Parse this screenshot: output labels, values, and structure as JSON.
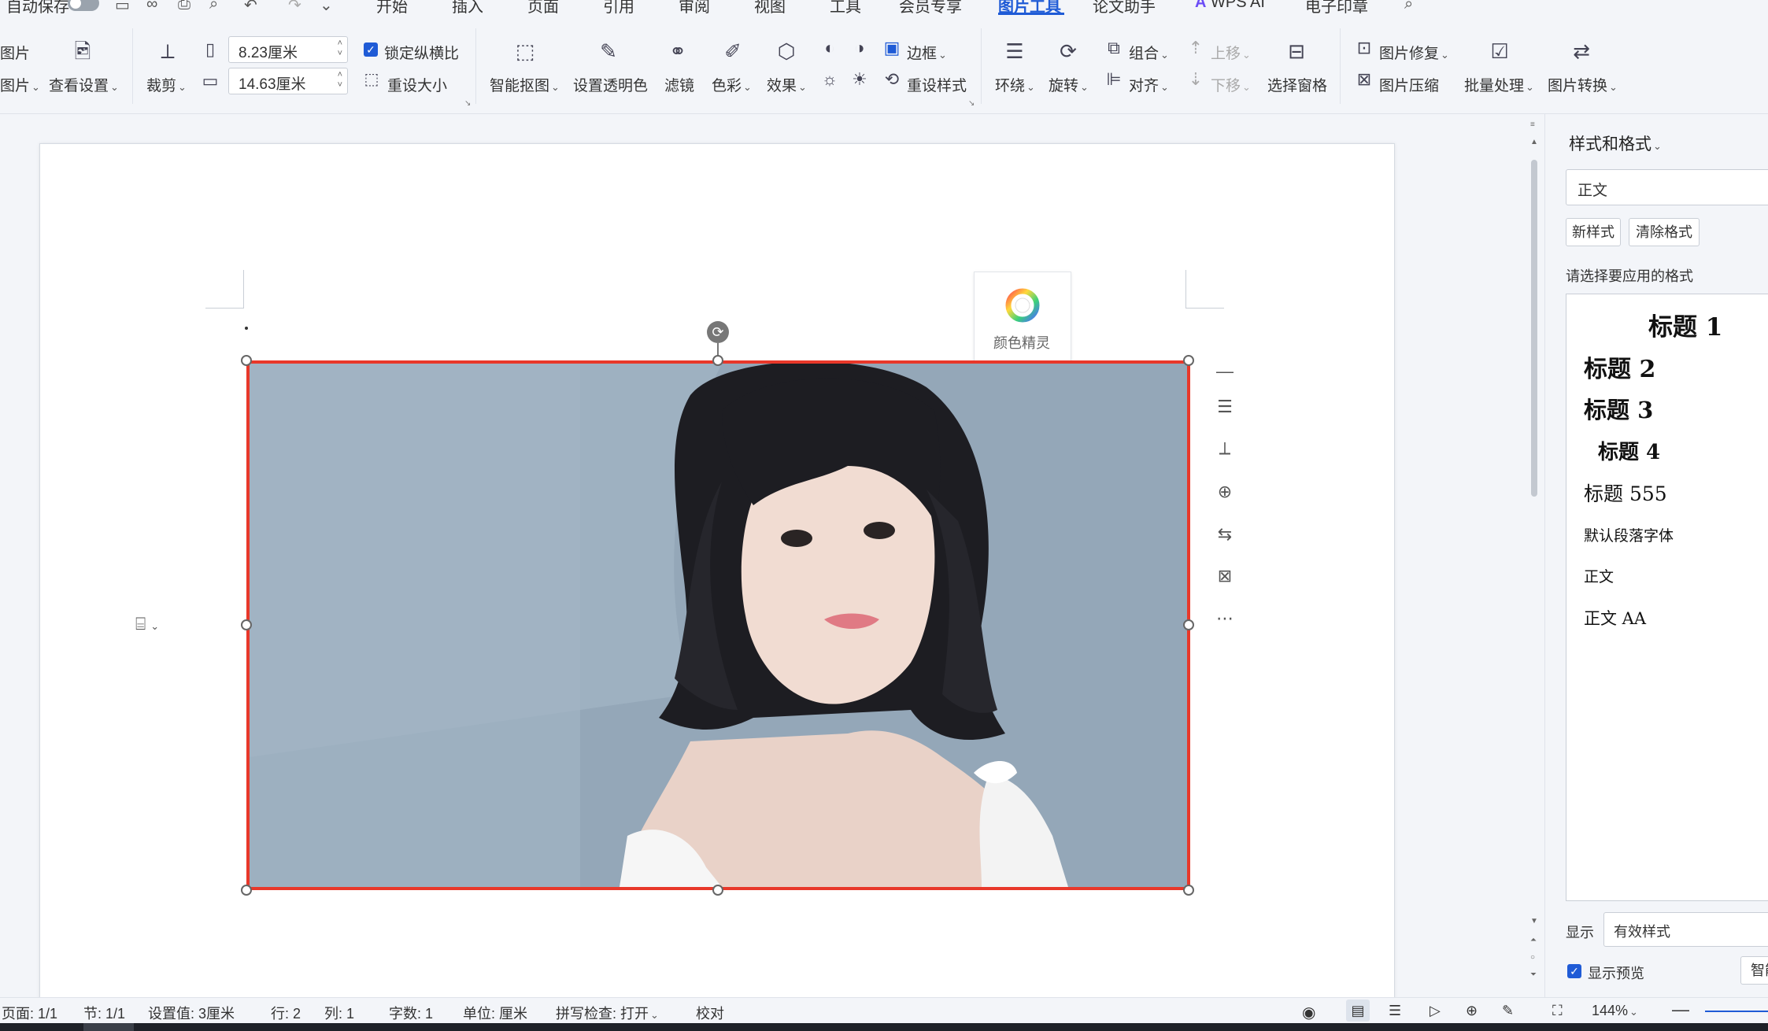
{
  "quick_access": {
    "autosave_label": "自动保存"
  },
  "menu": {
    "tabs": [
      "开始",
      "插入",
      "页面",
      "引用",
      "审阅",
      "视图",
      "工具",
      "会员专享",
      "图片工具",
      "论文助手",
      "WPS AI",
      "电子印章"
    ],
    "active_tab": "图片工具"
  },
  "ribbon": {
    "cut_off_1": "图片",
    "cut_off_2": "图片",
    "view_settings": "查看设置",
    "crop": "裁剪",
    "width_value": "8.23厘米",
    "height_value": "14.63厘米",
    "lock_ratio": "锁定纵横比",
    "reset_size": "重设大小",
    "smart_matting": "智能抠图",
    "set_transparent": "设置透明色",
    "filter": "滤镜",
    "color": "色彩",
    "effect": "效果",
    "border": "边框",
    "reset_style": "重设样式",
    "wrap": "环绕",
    "rotate": "旋转",
    "group": "组合",
    "align": "对齐",
    "move_up": "上移",
    "move_down": "下移",
    "selection_pane": "选择窗格",
    "image_repair": "图片修复",
    "image_compress": "图片压缩",
    "batch_process": "批量处理",
    "image_convert": "图片转换"
  },
  "document": {
    "color_sprite_label": "颜色精灵"
  },
  "panel": {
    "title": "样式和格式",
    "current_style": "正文",
    "new_style": "新样式",
    "clear_format": "清除格式",
    "prompt": "请选择要应用的格式",
    "styles": [
      "标题 1",
      "标题 2",
      "标题 3",
      "标题 4",
      "标题 555",
      "默认段落字体",
      "正文",
      "正文 AA"
    ],
    "show_label": "显示",
    "show_value": "有效样式",
    "show_preview": "显示预览",
    "smart_cut": "智能"
  },
  "status": {
    "page": "页面: 1/1",
    "section": "节: 1/1",
    "setting": "设置值: 3厘米",
    "row": "行: 2",
    "col": "列: 1",
    "words": "字数: 1",
    "unit": "单位: 厘米",
    "spell": "拼写检查: 打开",
    "proof": "校对",
    "zoom": "144%"
  },
  "colors": {
    "accent": "#1f5bd6",
    "selection_border": "#e8382a",
    "photo_background": "#94a7b8"
  }
}
